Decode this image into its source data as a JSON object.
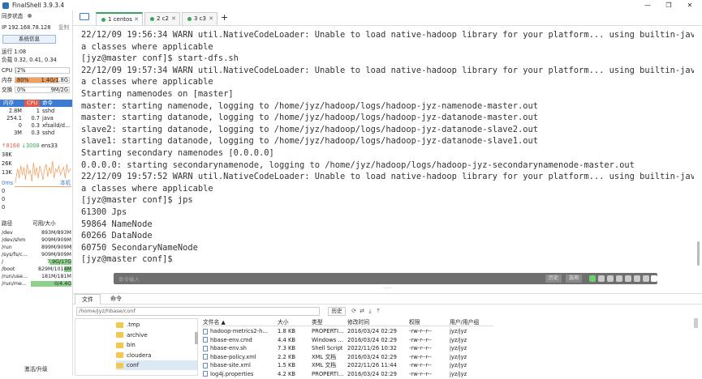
{
  "window": {
    "title": "FinalShell 3.9.3.4",
    "minimize": "—",
    "maximize": "❐",
    "close": "✕"
  },
  "sidebar": {
    "sync_status": "同步状态",
    "ip": "IP 192.168.78.128",
    "copy": "复制",
    "sys_info_button": "系统信息",
    "uptime": "运行 1:08",
    "load": "负载 0.32, 0.41, 0.34",
    "cpu": {
      "label": "CPU",
      "value": "2%",
      "fraction": 0.02
    },
    "mem": {
      "label": "内存",
      "percent": "80%",
      "value": "1.4G/1.8G",
      "fraction": 0.8
    },
    "swap": {
      "label": "交换",
      "percent": "0%",
      "value": "9M/2G",
      "fraction": 0.0
    },
    "proc_tabs": [
      "内存",
      "CPU",
      "命令"
    ],
    "processes": [
      {
        "mem": "2.8M",
        "cpu": "1",
        "cmd": "sshd"
      },
      {
        "mem": "254.1",
        "cpu": "0.7",
        "cmd": "java"
      },
      {
        "mem": "0",
        "cpu": "0.3",
        "cmd": "xfsaild/d..."
      },
      {
        "mem": "3M",
        "cpu": "0.3",
        "cmd": "sshd"
      }
    ],
    "net": {
      "up": "↑8168",
      "down": "↓3008",
      "iface": "ens33"
    },
    "net_scale": [
      "38K",
      "26K",
      "13K"
    ],
    "latency": {
      "label": "0ms",
      "host": "本机",
      "values": [
        "0",
        "0",
        "0"
      ]
    },
    "fs_header": {
      "path": "路径",
      "usage": "可用/大小"
    },
    "filesystems": [
      {
        "path": "/dev",
        "usage": "893M/893M",
        "fraction": 0.0
      },
      {
        "path": "/dev/shm",
        "usage": "909M/909M",
        "fraction": 0.0
      },
      {
        "path": "/run",
        "usage": "899M/909M",
        "fraction": 0.02
      },
      {
        "path": "/sys/fs/c...",
        "usage": "909M/909M",
        "fraction": 0.0
      },
      {
        "path": "/",
        "usage": "7.9G/17G",
        "fraction": 0.55
      },
      {
        "path": "/boot",
        "usage": "829M/1014M",
        "fraction": 0.18
      },
      {
        "path": "/run/use...",
        "usage": "181M/181M",
        "fraction": 0.0
      },
      {
        "path": "/run/me...",
        "usage": "0/4.4G",
        "fraction": 1.0
      }
    ],
    "activate": "激活/升级"
  },
  "tabs": [
    {
      "label": "1 centos",
      "active": true
    },
    {
      "label": "2 c2",
      "active": false
    },
    {
      "label": "3 c3",
      "active": false
    }
  ],
  "tab_add": "+",
  "terminal_lines": [
    "22/12/09 19:56:34 WARN util.NativeCodeLoader: Unable to load native-hadoop library for your platform... using builtin-jav",
    "a classes where applicable",
    "[jyz@master conf]$ start-dfs.sh",
    "22/12/09 19:57:34 WARN util.NativeCodeLoader: Unable to load native-hadoop library for your platform... using builtin-jav",
    "a classes where applicable",
    "Starting namenodes on [master]",
    "master: starting namenode, logging to /home/jyz/hadoop/logs/hadoop-jyz-namenode-master.out",
    "master: starting datanode, logging to /home/jyz/hadoop/logs/hadoop-jyz-datanode-master.out",
    "slave2: starting datanode, logging to /home/jyz/hadoop/logs/hadoop-jyz-datanode-slave2.out",
    "slave1: starting datanode, logging to /home/jyz/hadoop/logs/hadoop-jyz-datanode-slave1.out",
    "Starting secondary namenodes [0.0.0.0]",
    "0.0.0.0: starting secondarynamenode, logging to /home/jyz/hadoop/logs/hadoop-jyz-secondarynamenode-master.out",
    "22/12/09 19:57:52 WARN util.NativeCodeLoader: Unable to load native-hadoop library for your platform... using builtin-jav",
    "a classes where applicable",
    "[jyz@master conf]$ jps",
    "61300 Jps",
    "59864 NameNode",
    "60266 DataNode",
    "60750 SecondaryNameNode",
    "[jyz@master conf]$"
  ],
  "command_bar": {
    "placeholder": "命令输入",
    "history": "历史",
    "options": "选项"
  },
  "bottom_tabs": [
    "文件",
    "命令"
  ],
  "file_browser": {
    "path": "/home/jyz/hbase/conf",
    "history_button": "历史",
    "tree": [
      ".tmp",
      "archive",
      "bin",
      "cloudera",
      "conf"
    ],
    "columns": [
      "文件名 ▲",
      "大小",
      "类型",
      "修改时间",
      "权限",
      "用户/用户组"
    ],
    "files": [
      [
        "hadoop-metrics2-h...",
        "1.8 KB",
        "PROPERTI...",
        "2016/03/24 02:29",
        "-rw-r--r--",
        "jyz/jyz"
      ],
      [
        "hbase-env.cmd",
        "4.4 KB",
        "Windows ...",
        "2016/03/24 02:29",
        "-rw-r--r--",
        "jyz/jyz"
      ],
      [
        "hbase-env.sh",
        "7.3 KB",
        "Shell Script",
        "2022/11/26 10:32",
        "-rw-r--r--",
        "jyz/jyz"
      ],
      [
        "hbase-policy.xml",
        "2.2 KB",
        "XML 文档",
        "2016/03/24 02:29",
        "-rw-r--r--",
        "jyz/jyz"
      ],
      [
        "hbase-site.xml",
        "1.5 KB",
        "XML 文档",
        "2022/11/26 11:44",
        "-rw-r--r--",
        "jyz/jyz"
      ],
      [
        "log4j.properties",
        "4.2 KB",
        "PROPERTI...",
        "2016/03/24 02:29",
        "-rw-r--r--",
        "jyz/jyz"
      ]
    ]
  },
  "colors": {
    "accent": "#3b7bd1",
    "green": "#3aa55a",
    "mem_fill": "#f0a060",
    "fs_fill": "#8cd18c"
  }
}
